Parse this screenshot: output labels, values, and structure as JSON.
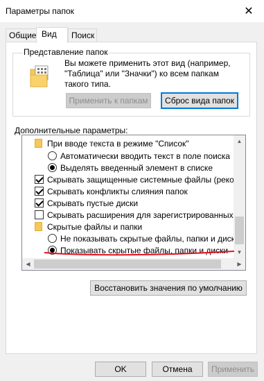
{
  "window": {
    "title": "Параметры папок",
    "close_glyph": "✕"
  },
  "tabs": [
    {
      "label": "Общие"
    },
    {
      "label": "Вид"
    },
    {
      "label": "Поиск"
    }
  ],
  "folder_view": {
    "legend": "Представление папок",
    "description": "Вы можете применить этот вид (например, \"Таблица\" или \"Значки\") ко всем папкам такого типа.",
    "apply_label": "Применить к папкам",
    "reset_label": "Сброс вида папок"
  },
  "advanced": {
    "label": "Дополнительные параметры:",
    "items": [
      {
        "kind": "folder",
        "label": "При вводе текста в режиме \"Список\""
      },
      {
        "kind": "radio",
        "checked": false,
        "label": "Автоматически вводить текст в поле поиска"
      },
      {
        "kind": "radio",
        "checked": true,
        "label": "Выделять введенный элемент в списке"
      },
      {
        "kind": "checkbox",
        "checked": true,
        "label": "Скрывать защищенные системные файлы (рекомен,"
      },
      {
        "kind": "checkbox",
        "checked": true,
        "label": "Скрывать конфликты слияния папок"
      },
      {
        "kind": "checkbox",
        "checked": true,
        "label": "Скрывать пустые диски"
      },
      {
        "kind": "checkbox",
        "checked": false,
        "label": "Скрывать расширения для зарегистрированных типо"
      },
      {
        "kind": "folder",
        "label": "Скрытые файлы и папки"
      },
      {
        "kind": "radio",
        "checked": false,
        "label": "Не показывать скрытые файлы, папки и диски"
      },
      {
        "kind": "radio",
        "checked": true,
        "label": "Показывать скрытые файлы, папки и диски"
      }
    ],
    "restore_label": "Восстановить значения по умолчанию"
  },
  "footer": {
    "ok_label": "OK",
    "cancel_label": "Отмена",
    "apply_label": "Применить"
  },
  "colors": {
    "accent": "#0078d7",
    "annotation": "#e0101f",
    "folder": "#f5c85a"
  }
}
